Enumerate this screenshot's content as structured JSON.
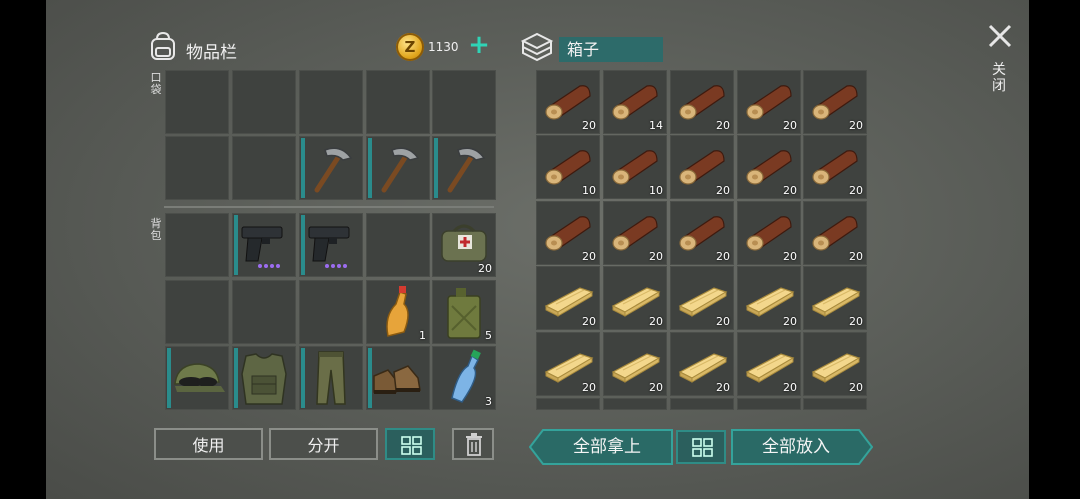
{
  "inventory": {
    "title": "物品栏",
    "coins": "1130",
    "coin_symbol": "Z",
    "pockets_label": "口袋",
    "backpack_label": "背包",
    "pocket_slots": [
      {
        "item": "",
        "count": ""
      },
      {
        "item": "",
        "count": ""
      },
      {
        "item": "",
        "count": ""
      },
      {
        "item": "",
        "count": ""
      },
      {
        "item": "",
        "count": ""
      },
      {
        "item": "",
        "count": ""
      },
      {
        "item": "",
        "count": ""
      },
      {
        "item": "pickaxe-icon",
        "count": "",
        "bar": true
      },
      {
        "item": "pickaxe-icon",
        "count": "",
        "bar": true
      },
      {
        "item": "pickaxe-icon",
        "count": "",
        "bar": true
      }
    ],
    "backpack_slots": [
      {
        "item": "",
        "count": ""
      },
      {
        "item": "pistol-icon",
        "count": "",
        "bar": true,
        "dots": 4
      },
      {
        "item": "pistol-icon",
        "count": "",
        "bar": true,
        "dots": 4
      },
      {
        "item": "",
        "count": ""
      },
      {
        "item": "medkit-bag-icon",
        "count": "20"
      },
      {
        "item": "",
        "count": ""
      },
      {
        "item": "",
        "count": ""
      },
      {
        "item": "",
        "count": ""
      },
      {
        "item": "drink-bottle-icon",
        "count": "1"
      },
      {
        "item": "jerrycan-icon",
        "count": "5"
      },
      {
        "item": "camo-cap-icon",
        "count": "",
        "bar": true
      },
      {
        "item": "camo-vest-icon",
        "count": "",
        "bar": true
      },
      {
        "item": "camo-pants-icon",
        "count": "",
        "bar": true
      },
      {
        "item": "boots-icon",
        "count": "",
        "bar": true
      },
      {
        "item": "water-bottle-icon",
        "count": "3"
      }
    ]
  },
  "box": {
    "title": "箱子",
    "slots": [
      {
        "item": "log-icon",
        "count": "20"
      },
      {
        "item": "log-icon",
        "count": "14"
      },
      {
        "item": "log-icon",
        "count": "20"
      },
      {
        "item": "log-icon",
        "count": "20"
      },
      {
        "item": "log-icon",
        "count": "20"
      },
      {
        "item": "log-icon",
        "count": "10"
      },
      {
        "item": "log-icon",
        "count": "10"
      },
      {
        "item": "log-icon",
        "count": "20"
      },
      {
        "item": "log-icon",
        "count": "20"
      },
      {
        "item": "log-icon",
        "count": "20"
      },
      {
        "item": "log-icon",
        "count": "20"
      },
      {
        "item": "log-icon",
        "count": "20"
      },
      {
        "item": "log-icon",
        "count": "20"
      },
      {
        "item": "log-icon",
        "count": "20"
      },
      {
        "item": "log-icon",
        "count": "20"
      },
      {
        "item": "plank-icon",
        "count": "20"
      },
      {
        "item": "plank-icon",
        "count": "20"
      },
      {
        "item": "plank-icon",
        "count": "20"
      },
      {
        "item": "plank-icon",
        "count": "20"
      },
      {
        "item": "plank-icon",
        "count": "20"
      },
      {
        "item": "plank-icon",
        "count": "20"
      },
      {
        "item": "plank-icon",
        "count": "20"
      },
      {
        "item": "plank-icon",
        "count": "20"
      },
      {
        "item": "plank-icon",
        "count": "20"
      },
      {
        "item": "plank-icon",
        "count": "20"
      }
    ]
  },
  "buttons": {
    "use": "使用",
    "split": "分开",
    "take_all": "全部拿上",
    "put_all": "全部放入",
    "close": "关闭"
  },
  "colors": {
    "accent": "#2a6a66",
    "coin": "#e0a41a",
    "bar": "#2a8c8c"
  }
}
